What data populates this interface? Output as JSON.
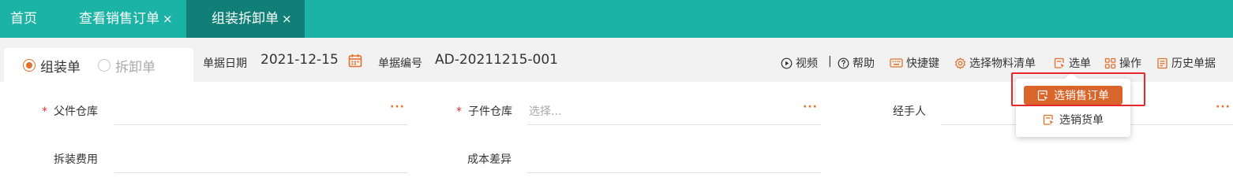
{
  "tabs": {
    "home": "首页",
    "view_order": "查看销售订单",
    "assembly": "组装拆卸单",
    "close": "×"
  },
  "mode": {
    "assemble": "组装单",
    "disassemble": "拆卸单",
    "selected": "assemble"
  },
  "doc": {
    "date_label": "单据日期",
    "date_value": "2021-12-15",
    "number_label": "单据编号",
    "number_value": "AD-20211215-001"
  },
  "tools": {
    "video": "视频",
    "separator": "|",
    "help": "帮助",
    "shortcut": "快捷键",
    "bom": "选择物料清单",
    "select": "选单",
    "operate": "操作",
    "history": "历史单据"
  },
  "form": {
    "required_mark": "*",
    "parent_wh": "父件仓库",
    "child_wh": "子件仓库",
    "child_wh_placeholder": "选择...",
    "handler": "经手人",
    "fee": "拆装费用",
    "cost_diff": "成本差异",
    "more": "···"
  },
  "dropdown": {
    "items": [
      "选销售订单",
      "选销货单"
    ],
    "highlighted": 0
  },
  "colors": {
    "tabbar": "#1ab3a6",
    "active_tab": "#0f7f77",
    "accent": "#e2702b",
    "highlight_box": "#e8272b"
  }
}
